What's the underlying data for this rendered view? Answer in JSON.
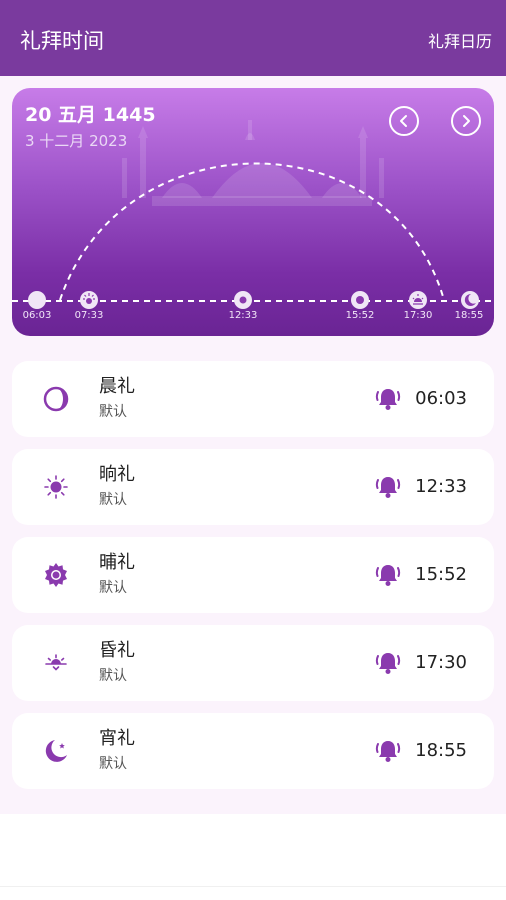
{
  "appbar": {
    "title": "礼拜时间",
    "action": "礼拜日历"
  },
  "header": {
    "hijri_date": "20 五月 1445",
    "gregorian_date": "3 十二月 2023",
    "prev_icon": "chevron-left-icon",
    "next_icon": "chevron-right-icon"
  },
  "timeline": {
    "ticks": [
      {
        "label": "06:03",
        "icon": "moon-icon"
      },
      {
        "label": "07:33",
        "icon": "sunrise-icon"
      },
      {
        "label": "12:33",
        "icon": "sun-icon"
      },
      {
        "label": "15:52",
        "icon": "sun-icon"
      },
      {
        "label": "17:30",
        "icon": "sunset-icon"
      },
      {
        "label": "18:55",
        "icon": "moon-icon"
      }
    ]
  },
  "prayers": [
    {
      "name": "晨礼",
      "sub": "默认",
      "time": "06:03",
      "icon": "half-moon-icon",
      "alarm_icon": "alarm-bell-icon"
    },
    {
      "name": "晌礼",
      "sub": "默认",
      "time": "12:33",
      "icon": "sun-icon",
      "alarm_icon": "alarm-bell-icon"
    },
    {
      "name": "晡礼",
      "sub": "默认",
      "time": "15:52",
      "icon": "sun-badge-icon",
      "alarm_icon": "alarm-bell-icon"
    },
    {
      "name": "昏礼",
      "sub": "默认",
      "time": "17:30",
      "icon": "sunset-icon",
      "alarm_icon": "alarm-bell-icon"
    },
    {
      "name": "宵礼",
      "sub": "默认",
      "time": "18:55",
      "icon": "crescent-star-icon",
      "alarm_icon": "alarm-bell-icon"
    }
  ],
  "colors": {
    "primary": "#7a3a9e",
    "accent": "#8a3aae",
    "background": "#fbf3fc",
    "card_gradient_top": "#c77ce8",
    "card_gradient_bottom": "#6a2494"
  }
}
